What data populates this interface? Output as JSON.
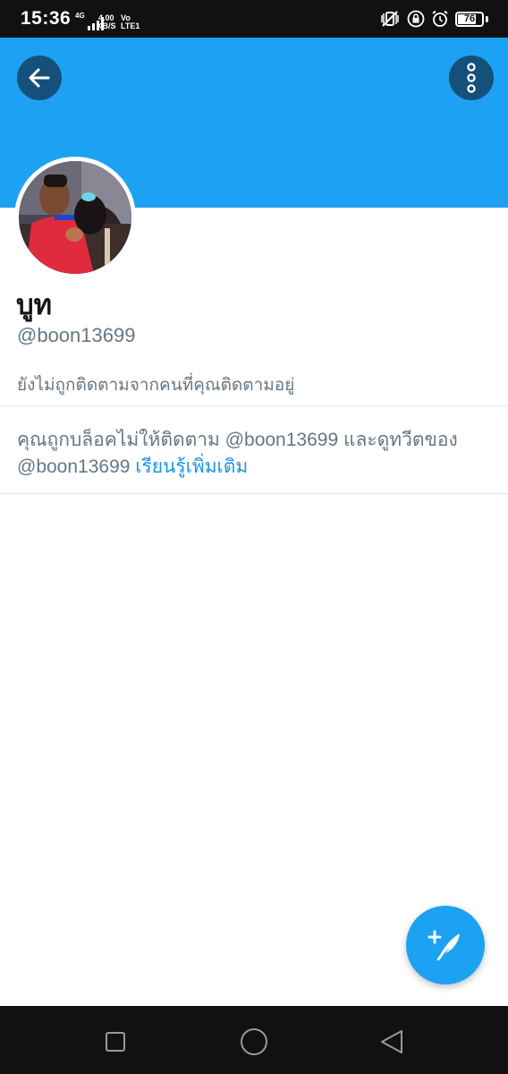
{
  "status_bar": {
    "time": "15:36",
    "network_type": "4G",
    "speed_value": "4.00",
    "speed_unit": "KB/S",
    "volte_top": "Vo",
    "volte_bottom": "LTE1",
    "battery": "76"
  },
  "header": {
    "back_icon": "arrow-left-icon",
    "more_icon": "more-vertical-icon",
    "banner_color": "#1da1f2"
  },
  "profile": {
    "display_name": "บูท",
    "handle": "@boon13699",
    "follow_status": "ยังไม่ถูกติดตามจากคนที่คุณติดตามอยู่"
  },
  "blocked_notice": {
    "message": "คุณถูกบล็อคไม่ให้ติดตาม @boon13699 และดูทวีตของ @boon13699",
    "learn_more": "เรียนรู้เพิ่มเติม",
    "link_color": "#1b95e0"
  },
  "fab": {
    "icon": "compose-tweet-icon"
  },
  "nav_bar": {
    "recent_icon": "square-icon",
    "home_icon": "circle-icon",
    "back_icon": "triangle-back-icon"
  }
}
